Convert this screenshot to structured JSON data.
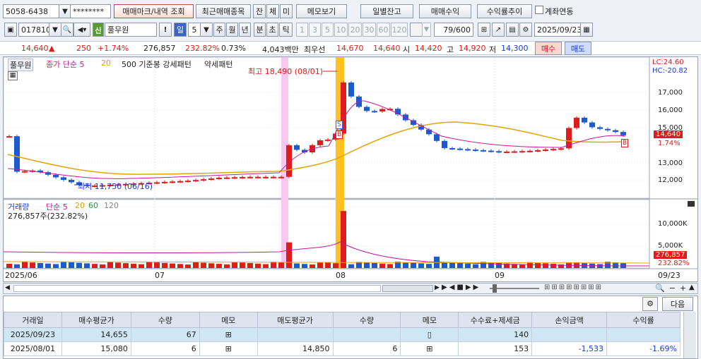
{
  "toolbar1": {
    "account": "5058-6438",
    "password": "********",
    "buy_sell_mark": "매매마크/내역 조회",
    "recent_items": "최근매매종목",
    "small_buttons": [
      "잔",
      "체",
      "미"
    ],
    "memo_view": "메모보기",
    "daily_balance": "일별잔고",
    "trade_profit": "매매수익",
    "profit_trend": "수익률추이",
    "account_link_label": "계좌연동"
  },
  "toolbar2": {
    "code": "017810",
    "badge": "신",
    "name": "풀무원",
    "period_day": "일",
    "period_num": "5",
    "periods": [
      "주",
      "월",
      "년",
      "분",
      "초",
      "틱"
    ],
    "nums": [
      "1",
      "3",
      "5",
      "10",
      "20",
      "30",
      "60",
      "120"
    ],
    "count": "79/600",
    "date": "2025/09/23"
  },
  "quote": {
    "price": "14,640",
    "arrow": "▲",
    "change": "250",
    "change_pct": "+1.74%",
    "volume": "276,857",
    "vol_ratio": "232.82%",
    "turnover": "0.73%",
    "amount": "4,043백만",
    "best_ask_label": "최우선",
    "best_ask": "14,670",
    "best_bid": "14,640",
    "open_label": "시",
    "open": "14,420",
    "high_label": "고",
    "high": "14,920",
    "low_label": "저",
    "low": "14,300",
    "buy": "매수",
    "sell": "매도"
  },
  "price_chart": {
    "title": "풀무원",
    "ma_label": "종가 단순 5",
    "ma2": "20",
    "pattern_label": "500 기준봉 강세패턴",
    "weak_label": "약세패턴",
    "high_annotation": "최고 18,490 (08/01)",
    "low_annotation": "최저 11,750 (06/16)",
    "lc": "LC:24.60",
    "hc": "HC:-20.82",
    "y_ticks": [
      "17,000",
      "16,000",
      "15,000",
      "14,000",
      "13,000",
      "12,000"
    ],
    "current_price": "14,640",
    "current_pct": "1.74%",
    "mark_s": "S",
    "mark_b": "B"
  },
  "volume_chart": {
    "title": "거래량",
    "ma_label": "단순 5",
    "ma_20": "20",
    "ma_60": "60",
    "ma_120": "120",
    "summary": "276,857주(232.82%)",
    "y_ticks": [
      "10,000K",
      "5,000K"
    ],
    "current_vol": "276,857",
    "current_pct": "232.82%"
  },
  "x_axis": {
    "labels": [
      "2025/06",
      "07",
      "08",
      "09"
    ],
    "end": "09/23"
  },
  "chart_data": {
    "type": "candlestick",
    "title": "풀무원",
    "x": [
      "2025/06",
      "07",
      "08",
      "09"
    ],
    "close_start": 12800,
    "close_end": 14640,
    "max_high": 18490,
    "max_high_date": "08/01",
    "min_low": 11750,
    "min_low_date": "06/16",
    "ylim": [
      11300,
      18900
    ],
    "volume_ylim": [
      0,
      12000
    ]
  },
  "table": {
    "next": "다음",
    "headers": [
      "거래일",
      "매수평균가",
      "수량",
      "메모",
      "매도평균가",
      "수량",
      "메모",
      "수수료+제세금",
      "손익금액",
      "수익률"
    ],
    "rows": [
      [
        "2025/09/23",
        "14,655",
        "67",
        "",
        "",
        "",
        "",
        "140",
        "",
        ""
      ],
      [
        "2025/08/01",
        "15,080",
        "6",
        "",
        "14,850",
        "6",
        "",
        "153",
        "-1,533",
        "-1.69%"
      ]
    ]
  }
}
